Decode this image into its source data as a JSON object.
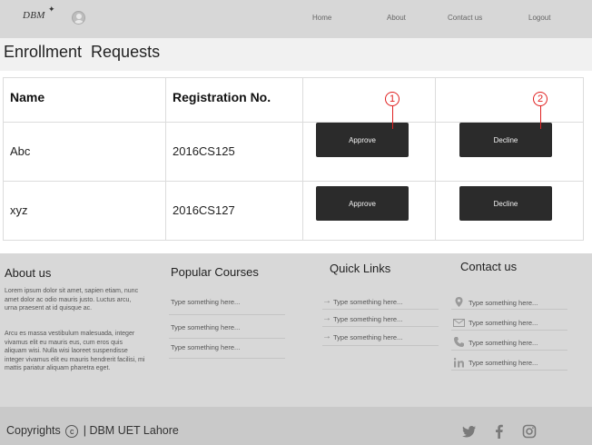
{
  "header": {
    "logo": "DBM",
    "nav": [
      "Home",
      "About",
      "Contact us",
      "Logout"
    ]
  },
  "page": {
    "title": "Enrollment  Requests"
  },
  "table": {
    "headers": [
      "Name",
      "Registration No."
    ],
    "rows": [
      {
        "name": "Abc",
        "reg": "2016CS125",
        "approve": "Approve",
        "decline": "Decline"
      },
      {
        "name": "xyz",
        "reg": "2016CS127",
        "approve": "Approve",
        "decline": "Decline"
      }
    ],
    "annotations": [
      "1",
      "2"
    ]
  },
  "footer": {
    "about": {
      "title": "About us",
      "para1": "Lorem ipsum dolor sit amet, sapien etiam, nunc amet dolor ac odio mauris justo. Luctus arcu, urna praesent at id quisque ac.",
      "para2": "Arcu es massa vestibulum malesuada, integer vivamus elit eu mauris eus, cum eros quis aliquam wisi. Nulla wisi laoreet suspendisse integer vivamus elit eu mauris hendrerit facilisi, mi mattis pariatur aliquam pharetra eget."
    },
    "courses": {
      "title": "Popular Courses",
      "items": [
        "Type something here...",
        "Type something here...",
        "Type something here..."
      ]
    },
    "quicklinks": {
      "title": "Quick Links",
      "items": [
        "Type something here...",
        "Type something here...",
        "Type something here..."
      ]
    },
    "contact": {
      "title": "Contact us",
      "items": [
        {
          "icon": "location-icon",
          "text": "Type something here..."
        },
        {
          "icon": "mail-icon",
          "text": "Type something here..."
        },
        {
          "icon": "phone-icon",
          "text": "Type something here..."
        },
        {
          "icon": "linkedin-icon",
          "text": "Type something here..."
        }
      ]
    }
  },
  "bottombar": {
    "copyright_prefix": "Copyrights",
    "copyright_symbol": "c",
    "copyright_suffix": "| DBM UET Lahore",
    "social": [
      "twitter-icon",
      "facebook-icon",
      "instagram-icon"
    ]
  },
  "colors": {
    "button_bg": "#2b2b2b",
    "marker": "#e02020",
    "footer_bg": "#d8d8d8"
  }
}
